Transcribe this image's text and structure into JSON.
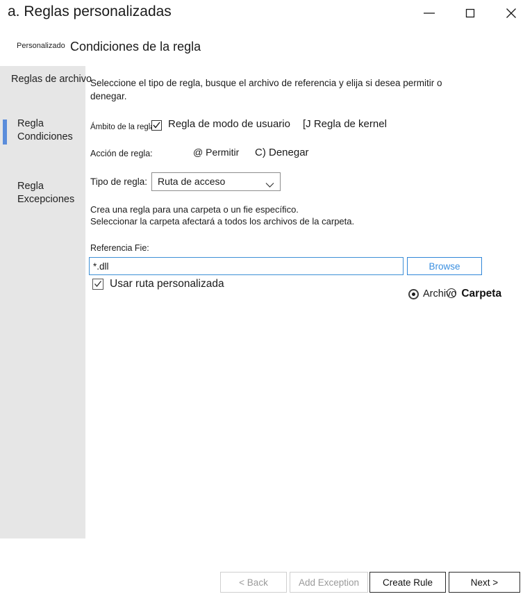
{
  "window": {
    "title": "a. Reglas personalizadas",
    "controls": {
      "minimize": "minimize-icon",
      "maximize": "maximize-icon",
      "close": "close-icon"
    }
  },
  "header": {
    "breadcrumb": "Personalizado",
    "heading": "Condiciones de la regla"
  },
  "sidebar": {
    "items": [
      {
        "label": "Reglas de archivo",
        "active": false
      },
      {
        "label": "Regla Condiciones",
        "active": true
      },
      {
        "label": "Regla Excepciones",
        "active": false
      }
    ],
    "accent_color": "#5b8ddb",
    "background_color": "#e6e6e6"
  },
  "main": {
    "intro_text": "Seleccione el tipo de regla, busque el archivo de referencia y elija si desea permitir o denegar.",
    "scope": {
      "label": "Ámbito de la regla:",
      "checkbox_checked": true,
      "user_mode_option": "Regla de modo de usuario",
      "kernel_option": "[J Regla de kernel"
    },
    "action": {
      "label": "Acción de regla:",
      "allow_option": "@ Permitir",
      "deny_option": "C) Denegar"
    },
    "rule_type": {
      "label": "Tipo de regla:",
      "value": "Ruta de acceso",
      "chevron": "chevron-down-icon"
    },
    "helper_text_line1": "Crea una regla para una carpeta o un fie específico.",
    "helper_text_line2": "Seleccionar la carpeta afectará a todos los archivos de la carpeta.",
    "reference": {
      "label": "Referencia  Fie:",
      "value": "*.dll",
      "placeholder": "",
      "browse_label": "Browse",
      "focus_color": "#3d8fd6",
      "browse_color": "#3a8fe0"
    },
    "custom_path": {
      "label": "Usar ruta personalizada",
      "checked": true
    },
    "file_folder": {
      "file_label": "Archivo",
      "folder_label": "Carpeta",
      "selected": "Archivo"
    }
  },
  "footer": {
    "buttons": [
      {
        "label": "< Back",
        "state": "disabled"
      },
      {
        "label": "Add Exception",
        "state": "disabled"
      },
      {
        "label": "Create Rule",
        "state": "primary"
      },
      {
        "label": "Next >",
        "state": "primary"
      }
    ]
  }
}
